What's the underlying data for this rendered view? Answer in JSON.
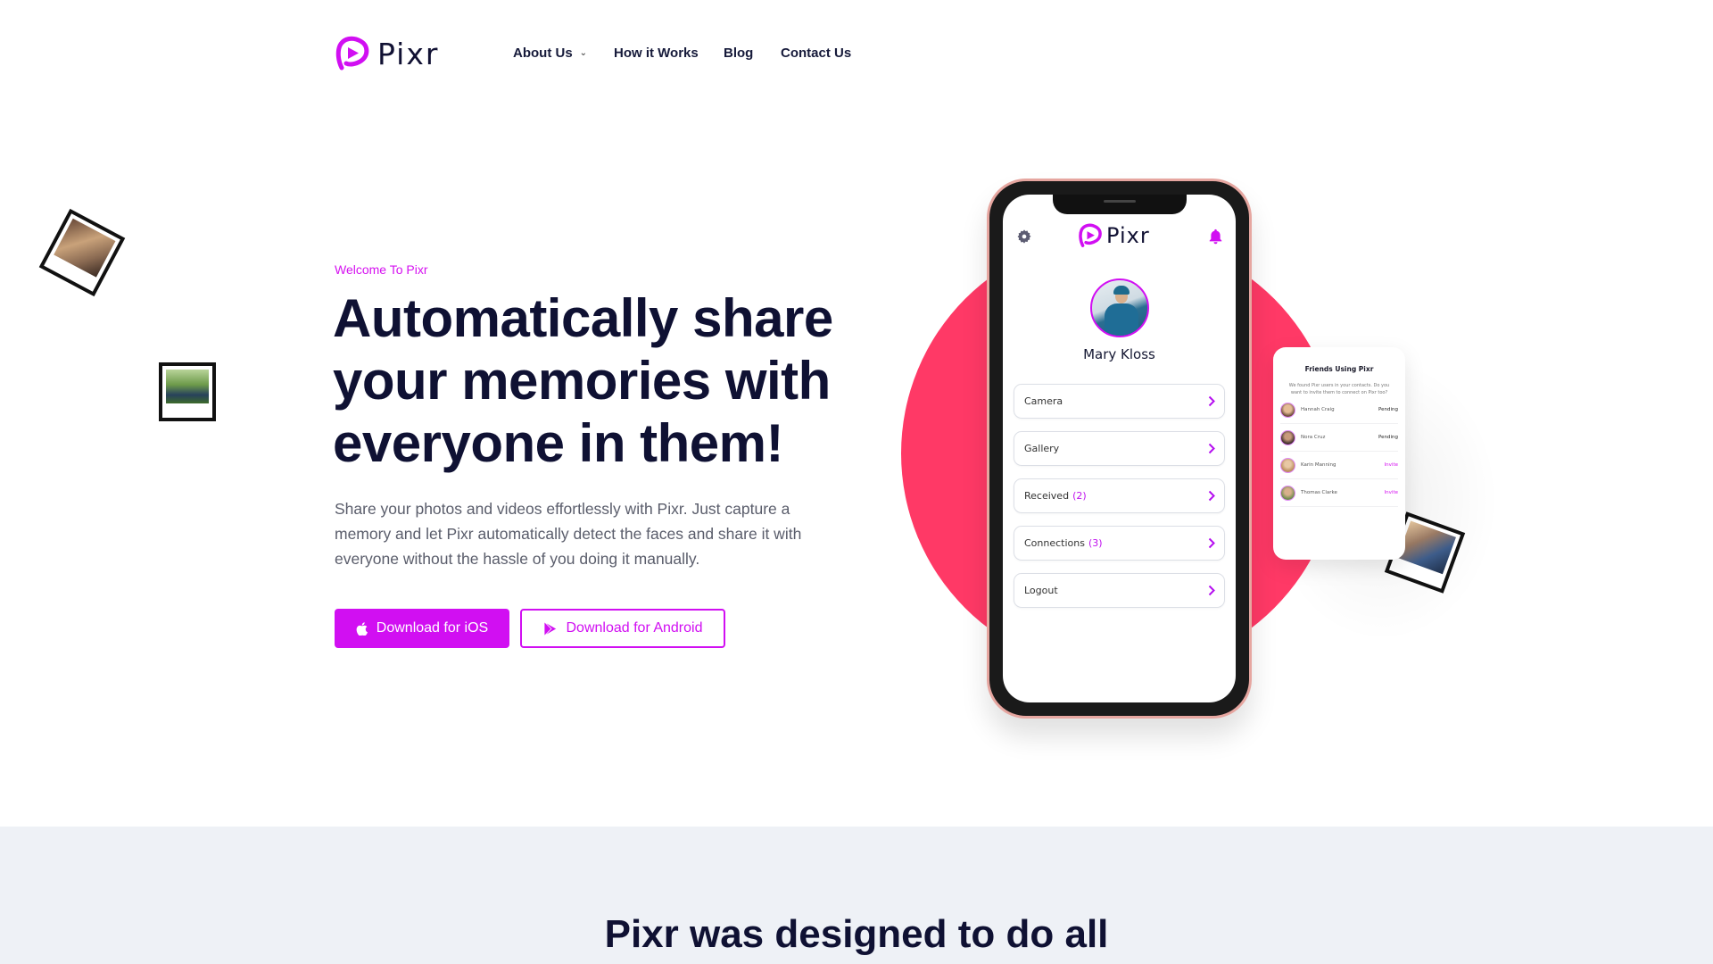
{
  "brand": {
    "name": "Pixr",
    "accent": "#D10FF2",
    "circle": "#FF3966",
    "dark": "#0F1133"
  },
  "nav": {
    "items": [
      {
        "label": "About Us",
        "has_dropdown": true
      },
      {
        "label": "How it Works",
        "has_dropdown": false
      },
      {
        "label": "Blog",
        "has_dropdown": false
      },
      {
        "label": "Contact Us",
        "has_dropdown": false
      }
    ]
  },
  "hero": {
    "eyebrow": "Welcome To Pixr",
    "title": "Automatically share your memories with everyone in them!",
    "description": "Share your photos and videos effortlessly with Pixr. Just capture a memory and let Pixr automatically detect the faces and share it with everyone without the hassle of you doing it manually.",
    "buttons": {
      "ios": {
        "label": "Download for iOS",
        "icon": "apple-icon"
      },
      "android": {
        "label": "Download for Android",
        "icon": "play-store-icon"
      }
    }
  },
  "phone": {
    "app_name": "Pixr",
    "profile_name": "Mary Kloss",
    "menu": [
      {
        "label": "Camera",
        "count": null
      },
      {
        "label": "Gallery",
        "count": null
      },
      {
        "label": "Received",
        "count": "(2)"
      },
      {
        "label": "Connections",
        "count": "(3)"
      },
      {
        "label": "Logout",
        "count": null
      }
    ]
  },
  "friends_card": {
    "title": "Friends Using Pixr",
    "description": "We found Pixr users in your contacts. Do you want to invite them to connect on Pixr too?",
    "friends": [
      {
        "name": "Hannah Craig",
        "status": "Pending"
      },
      {
        "name": "Nora Cruz",
        "status": "Pending"
      },
      {
        "name": "Karin Manning",
        "status": "Invite"
      },
      {
        "name": "Thomas Clarke",
        "status": "Invite"
      }
    ]
  },
  "lower": {
    "title": "Pixr was designed to do all"
  }
}
